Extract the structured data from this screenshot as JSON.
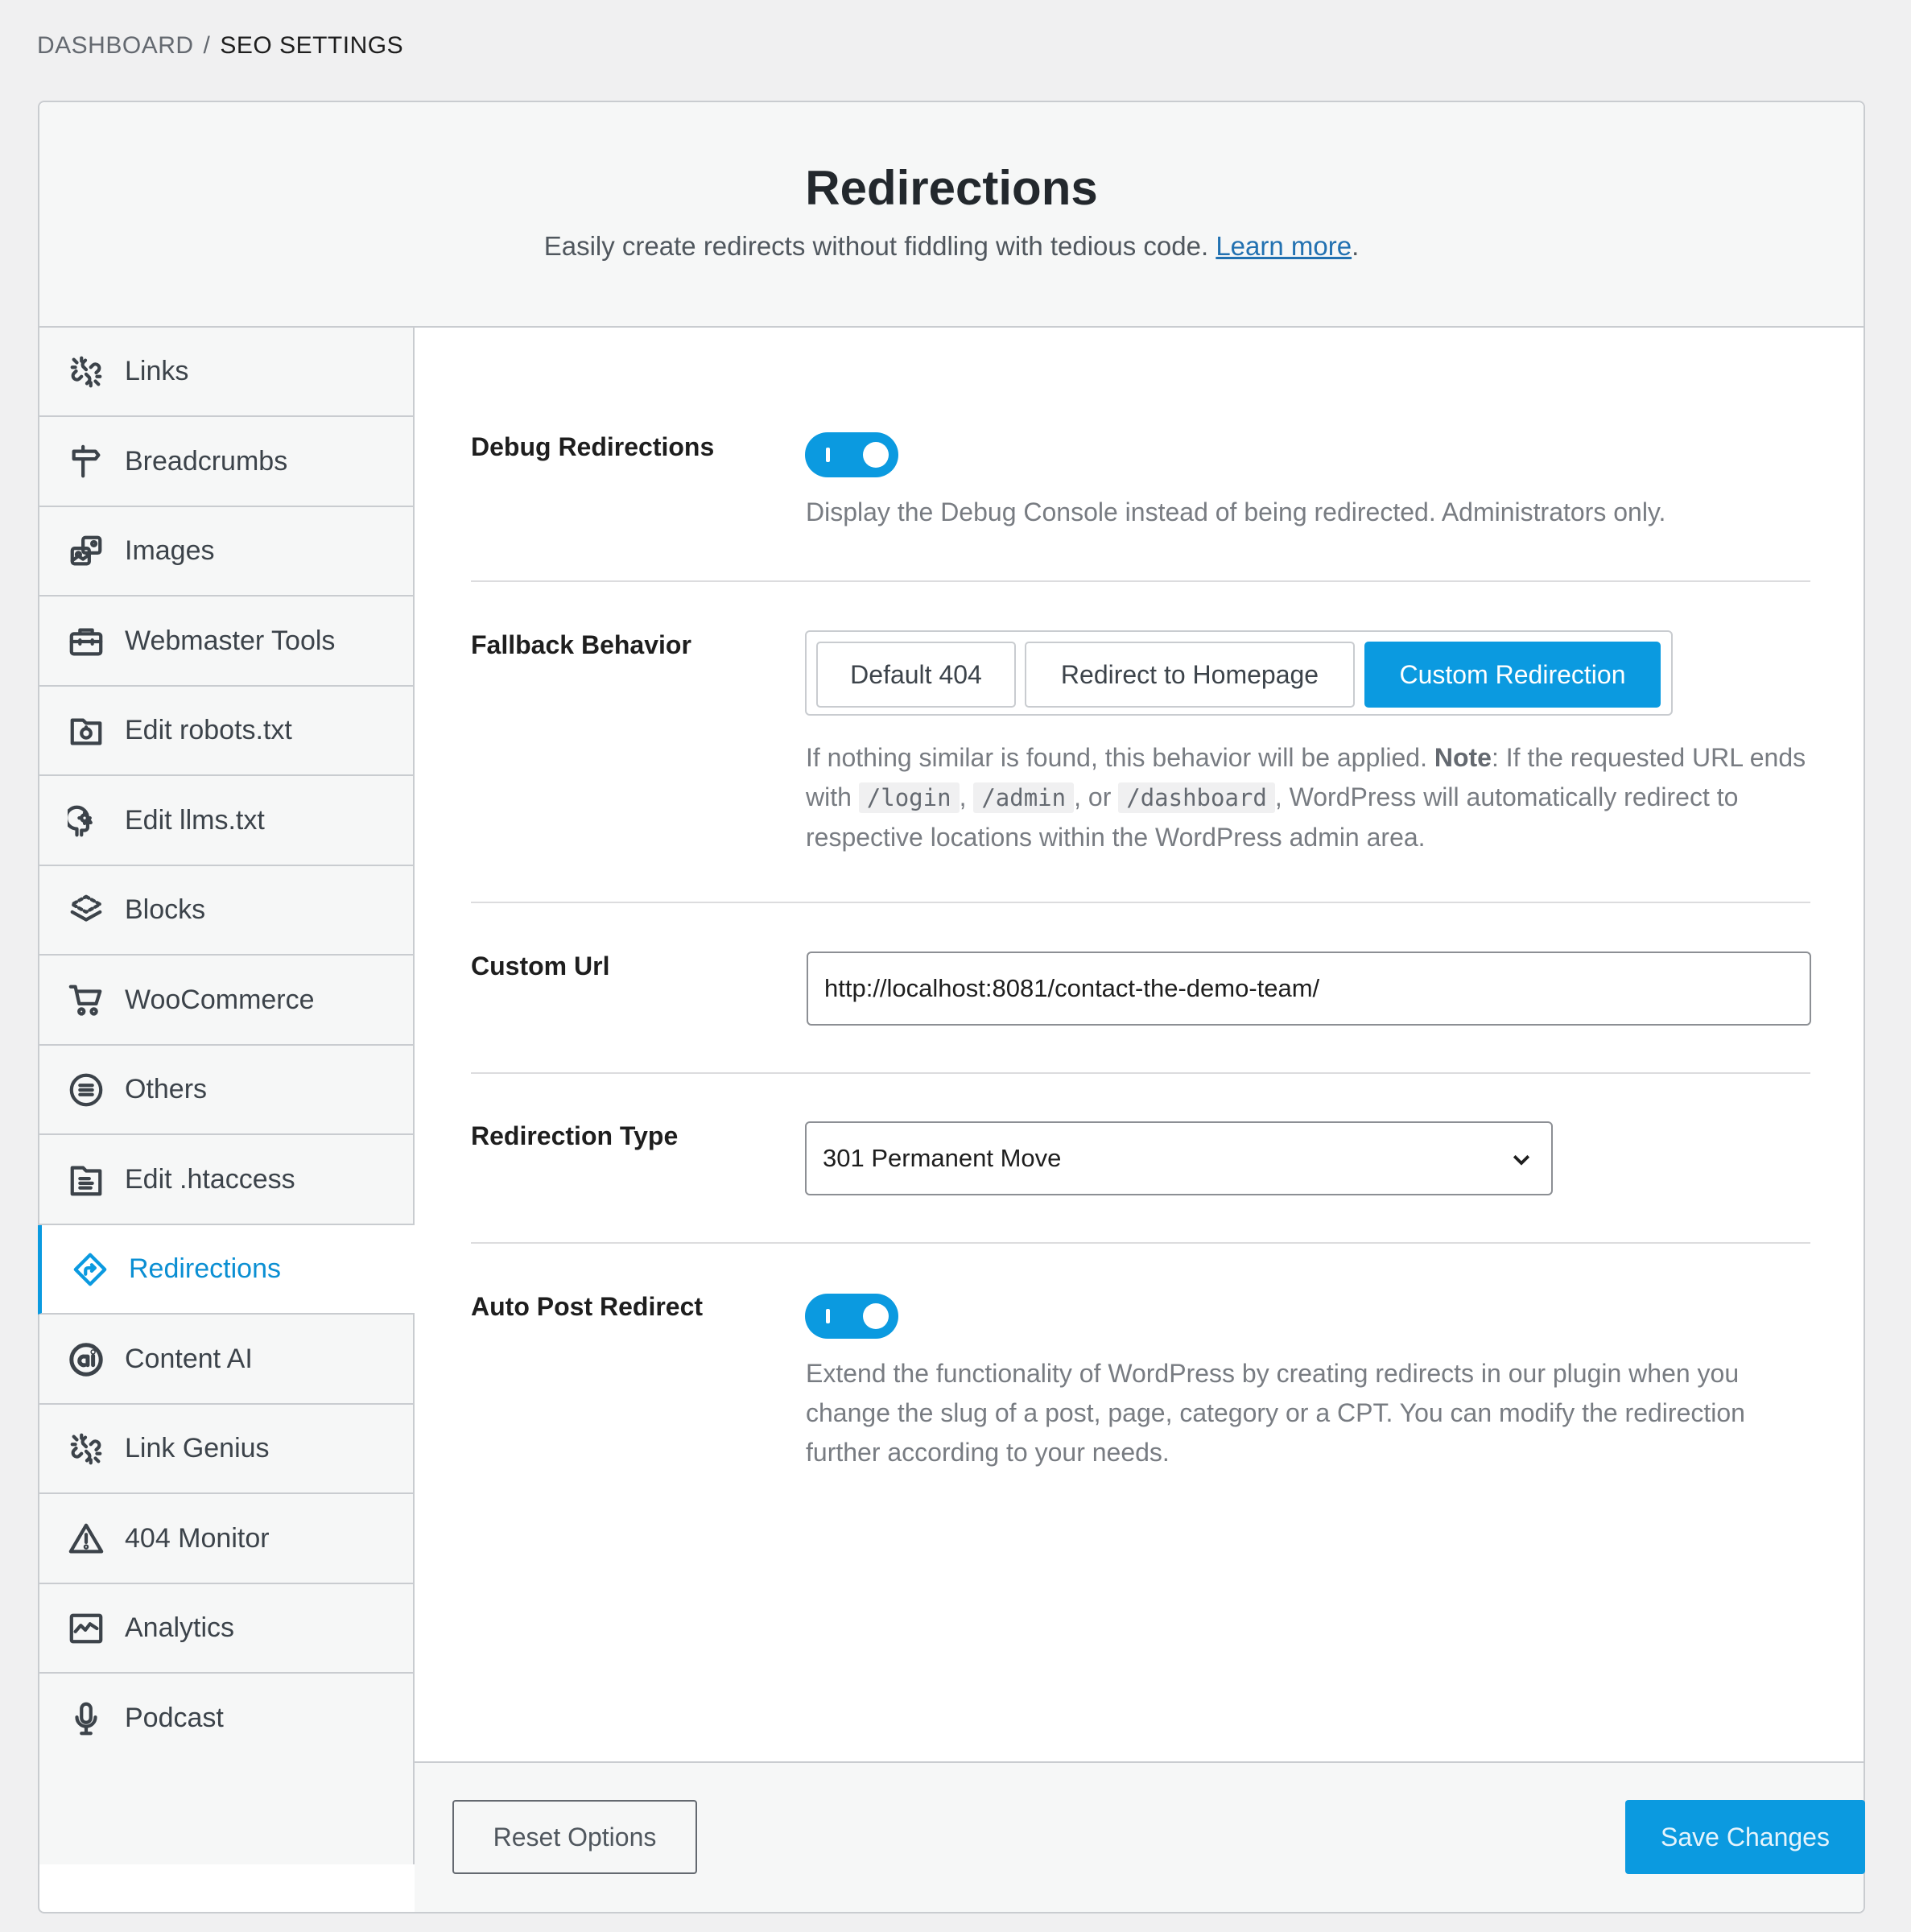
{
  "breadcrumb": {
    "root": "DASHBOARD",
    "separator": "/",
    "current": "SEO SETTINGS"
  },
  "header": {
    "title": "Redirections",
    "description": "Easily create redirects without fiddling with tedious code.",
    "learn_more": "Learn more",
    "period": "."
  },
  "sidebar": {
    "items": [
      {
        "label": "Links",
        "icon": "link-broken-icon"
      },
      {
        "label": "Breadcrumbs",
        "icon": "signpost-icon"
      },
      {
        "label": "Images",
        "icon": "images-icon"
      },
      {
        "label": "Webmaster Tools",
        "icon": "toolbox-icon"
      },
      {
        "label": "Edit robots.txt",
        "icon": "robots-file-icon"
      },
      {
        "label": "Edit llms.txt",
        "icon": "ai-head-icon"
      },
      {
        "label": "Blocks",
        "icon": "blocks-icon"
      },
      {
        "label": "WooCommerce",
        "icon": "cart-icon"
      },
      {
        "label": "Others",
        "icon": "list-circle-icon"
      },
      {
        "label": "Edit .htaccess",
        "icon": "file-text-icon"
      },
      {
        "label": "Redirections",
        "icon": "redirect-icon",
        "active": true
      },
      {
        "label": "Content AI",
        "icon": "content-ai-icon"
      },
      {
        "label": "Link Genius",
        "icon": "link-genius-icon"
      },
      {
        "label": "404 Monitor",
        "icon": "warning-icon"
      },
      {
        "label": "Analytics",
        "icon": "analytics-icon"
      },
      {
        "label": "Podcast",
        "icon": "microphone-icon"
      }
    ]
  },
  "settings": {
    "debug": {
      "label": "Debug Redirections",
      "enabled": true,
      "help": "Display the Debug Console instead of being redirected. Administrators only."
    },
    "fallback": {
      "label": "Fallback Behavior",
      "options": [
        "Default 404",
        "Redirect to Homepage",
        "Custom Redirection"
      ],
      "selected": "Custom Redirection",
      "help_pre": "If nothing similar is found, this behavior will be applied.",
      "help_note": "Note",
      "help_note_after": ": If the requested URL ends with",
      "code1": "/login",
      "comma1": ",",
      "code2": "/admin",
      "or_text": ", or",
      "code3": "/dashboard",
      "help_post": ", WordPress will automatically redirect to respective locations within the WordPress admin area."
    },
    "custom_url": {
      "label": "Custom Url",
      "value": "http://localhost:8081/contact-the-demo-team/"
    },
    "redirection_type": {
      "label": "Redirection Type",
      "value": "301 Permanent Move"
    },
    "auto_post": {
      "label": "Auto Post Redirect",
      "enabled": true,
      "help": "Extend the functionality of WordPress by creating redirects in our plugin when you change the slug of a post, page, category or a CPT. You can modify the redirection further according to your needs."
    }
  },
  "footer": {
    "reset_label": "Reset Options",
    "save_label": "Save Changes"
  },
  "colors": {
    "accent": "#0b9ae0",
    "link": "#2271b1",
    "background": "#f0f0f1"
  }
}
